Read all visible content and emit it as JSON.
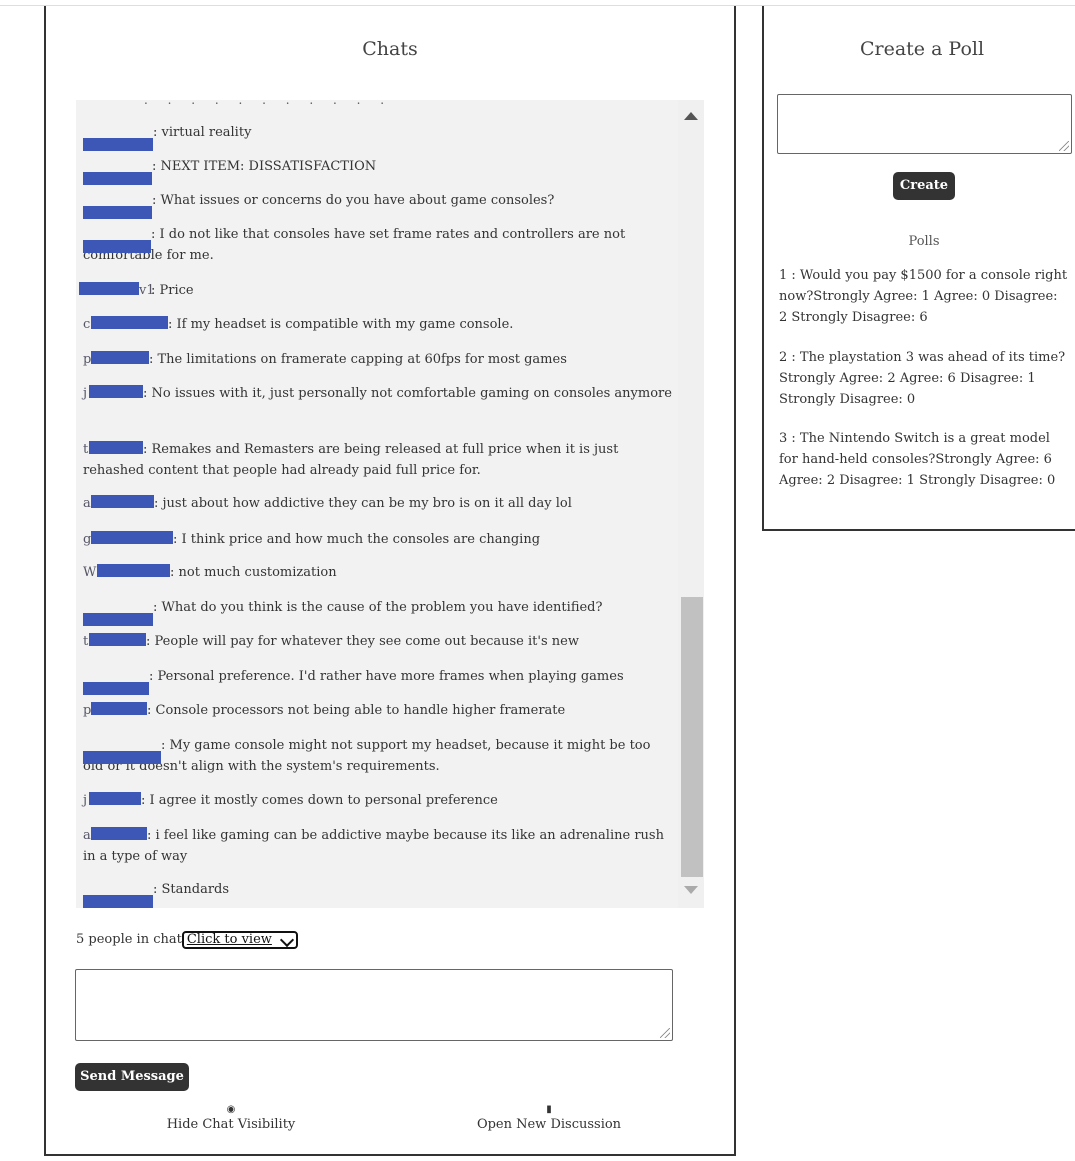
{
  "chats": {
    "title": "Chats",
    "messages": [
      {
        "user": "",
        "text": ": virtual reality"
      },
      {
        "user": "",
        "text": ": NEXT ITEM: DISSATISFACTION"
      },
      {
        "user": "",
        "text": ": What issues or concerns do you have about game consoles?"
      },
      {
        "user": "",
        "text": ": I do not like that consoles have set frame rates and controllers are not comfortable for me."
      },
      {
        "user": "v1",
        "text": ": Price"
      },
      {
        "user": "c",
        "text": ": If my headset is compatible with my game console."
      },
      {
        "user": "p",
        "text": ": The limitations on framerate capping at 60fps for most games"
      },
      {
        "user": "j",
        "text": ": No issues with it, just personally not comfortable gaming on consoles anymore"
      },
      {
        "user": "t",
        "text": ": Remakes and Remasters are being released at full price when it is just rehashed content that people had already paid full price for."
      },
      {
        "user": "a",
        "text": ": just about how addictive they can be my bro is on it all day lol"
      },
      {
        "user": "g",
        "text": ": I think price and how much the consoles are changing"
      },
      {
        "user": "W",
        "text": ": not much customization"
      },
      {
        "user": "",
        "text": ": What do you think is the cause of the problem you have identified?"
      },
      {
        "user": "t",
        "text": ": People will pay for whatever they see come out because it's new"
      },
      {
        "user": "",
        "text": ": Personal preference. I'd rather have more frames when playing games"
      },
      {
        "user": "p",
        "text": ": Console processors not being able to handle higher framerate"
      },
      {
        "user": "",
        "text": ": My game console might not support my headset, because it might be too old or it doesn't align with the system's requirements."
      },
      {
        "user": "j",
        "text": ": I agree it mostly comes down to personal preference"
      },
      {
        "user": "a",
        "text": ": i feel like gaming can be addictive maybe because its like an adrenaline rush in a type of way"
      },
      {
        "user": "",
        "text": ": Standards"
      }
    ],
    "people_text": "5 people in chat",
    "people_select": "Click to view",
    "send_label": "Send Message",
    "hide_label": "Hide Chat Visibility",
    "open_label": "Open New Discussion"
  },
  "poll": {
    "title": "Create a Poll",
    "create_label": "Create",
    "polls_heading": "Polls",
    "items": [
      "1 : Would you pay $1500 for a console right now?Strongly Agree: 1 Agree: 0 Disagree: 2 Strongly Disagree: 6",
      "2 : The playstation 3 was ahead of its time?Strongly Agree: 2 Agree: 6 Disagree: 1 Strongly Disagree: 0",
      "3 : The Nintendo Switch is a great model for hand-held consoles?Strongly Agree: 6 Agree: 2 Disagree: 1 Strongly Disagree: 0"
    ]
  },
  "colors": {
    "redaction": "#3d57b6",
    "button": "#333333"
  }
}
